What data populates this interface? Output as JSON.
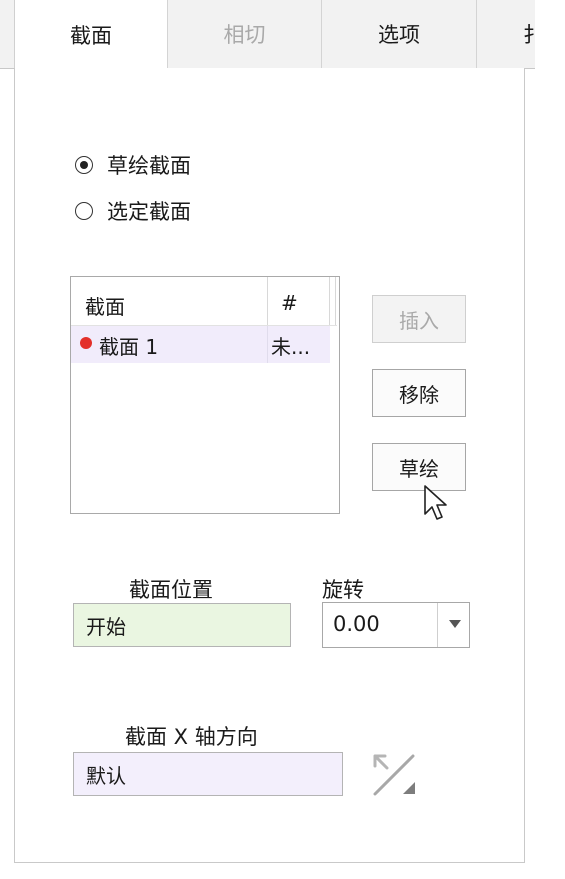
{
  "tabs": [
    {
      "label": "截面",
      "state": "active"
    },
    {
      "label": "相切",
      "state": "disabled"
    },
    {
      "label": "选项",
      "state": "normal"
    },
    {
      "label": "扌",
      "state": "normal"
    }
  ],
  "section_mode": {
    "options": [
      {
        "label": "草绘截面",
        "checked": true
      },
      {
        "label": "选定截面",
        "checked": false
      }
    ]
  },
  "section_list": {
    "columns": [
      "截面",
      "#"
    ],
    "rows": [
      {
        "name": "截面 1",
        "count": "未...",
        "status_color": "#e3302a"
      }
    ]
  },
  "buttons": {
    "insert": "插入",
    "remove": "移除",
    "sketch": "草绘"
  },
  "position": {
    "label": "截面位置",
    "value": "开始"
  },
  "rotation": {
    "label": "旋转",
    "value": "0.00"
  },
  "x_axis": {
    "label": "截面 X 轴方向",
    "value": "默认"
  },
  "colors": {
    "position_field_bg": "#eaf6e1",
    "x_axis_field_bg": "#f3effc",
    "selected_row_bg": "#f1ecfb"
  }
}
